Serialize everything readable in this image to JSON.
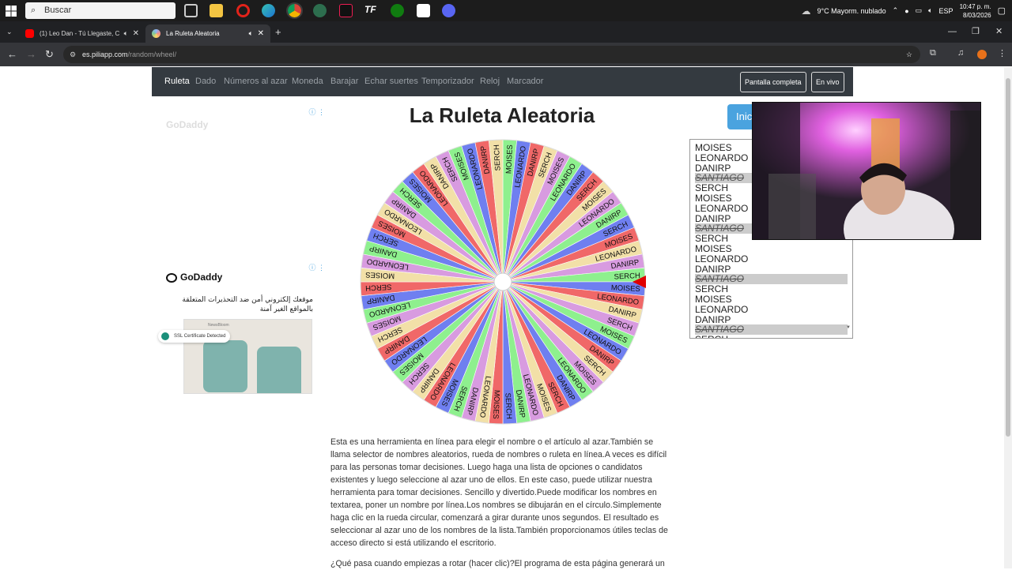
{
  "taskbar": {
    "search_placeholder": "Buscar",
    "weather": "9°C  Mayorm. nublado",
    "lang": "ESP",
    "time": "10:47 p. m.",
    "date": "8/03/2026"
  },
  "tabs": [
    {
      "title": "(1) Leo Dan - Tú Llegaste, C",
      "favicon_color": "#ff0000"
    },
    {
      "title": "La Ruleta Aleatoria",
      "favicon_color": "#8ab4f8"
    }
  ],
  "address": {
    "domain": "es.piliapp.com",
    "path": "/random/wheel/"
  },
  "site_nav": {
    "items": [
      "Ruleta",
      "Dado",
      "Números al azar",
      "Moneda",
      "Barajar",
      "Echar suertes",
      "Temporizador",
      "Reloj",
      "Marcador"
    ],
    "fullscreen": "Pantalla completa",
    "live": "En vivo"
  },
  "ads": {
    "brand": "GoDaddy",
    "arabic_text": "موقعك إلكتروني أمن ضد التحذيرات المتعلقة بالمواقع الغير آمنة",
    "ssl_badge": "SSL Certificate Detected",
    "photo_caption": "NewsBloom"
  },
  "page": {
    "title": "La Ruleta Aleatoria",
    "start_button": "Inic"
  },
  "wheel": {
    "names": [
      "MOISES",
      "LEONARDO",
      "DANIRP",
      "SERCH"
    ],
    "colors": [
      "#8ef08e",
      "#6f7ff0",
      "#f06868",
      "#f2e0a8",
      "#d89be0"
    ],
    "segment_count": 64,
    "pointer_color": "#e00000"
  },
  "names_list": [
    {
      "name": "MOISES",
      "struck": false
    },
    {
      "name": "LEONARDO",
      "struck": false
    },
    {
      "name": "DANIRP",
      "struck": false
    },
    {
      "name": "SANTIAGO",
      "struck": true
    },
    {
      "name": "SERCH",
      "struck": false
    },
    {
      "name": "MOISES",
      "struck": false
    },
    {
      "name": "LEONARDO",
      "struck": false
    },
    {
      "name": "DANIRP",
      "struck": false
    },
    {
      "name": "SANTIAGO",
      "struck": true
    },
    {
      "name": "SERCH",
      "struck": false
    },
    {
      "name": "MOISES",
      "struck": false
    },
    {
      "name": "LEONARDO",
      "struck": false
    },
    {
      "name": "DANIRP",
      "struck": false
    },
    {
      "name": "SANTIAGO",
      "struck": true
    },
    {
      "name": "SERCH",
      "struck": false
    },
    {
      "name": "MOISES",
      "struck": false
    },
    {
      "name": "LEONARDO",
      "struck": false
    },
    {
      "name": "DANIRP",
      "struck": false
    },
    {
      "name": "SANTIAGO",
      "struck": true
    },
    {
      "name": "SERCH",
      "struck": false
    }
  ],
  "description": {
    "p1": "Esta es una herramienta en línea para elegir el nombre o el artículo al azar.También se llama selector de nombres aleatorios, rueda de nombres o ruleta en línea.A veces es difícil para las personas tomar decisiones. Luego haga una lista de opciones o candidatos existentes y luego seleccione al azar uno de ellos. En este caso, puede utilizar nuestra herramienta para tomar decisiones. Sencillo y divertido.Puede modificar los nombres en textarea, poner un nombre por línea.Los nombres se dibujarán en el círculo.Simplemente haga clic en la rueda circular, comenzará a girar durante unos segundos. El resultado es seleccionar al azar uno de los nombres de la lista.También proporcionamos útiles teclas de acceso directo si está utilizando el escritorio.",
    "p2": "¿Qué pasa cuando empiezas a rotar (hacer clic)?El programa de esta página generará un"
  }
}
